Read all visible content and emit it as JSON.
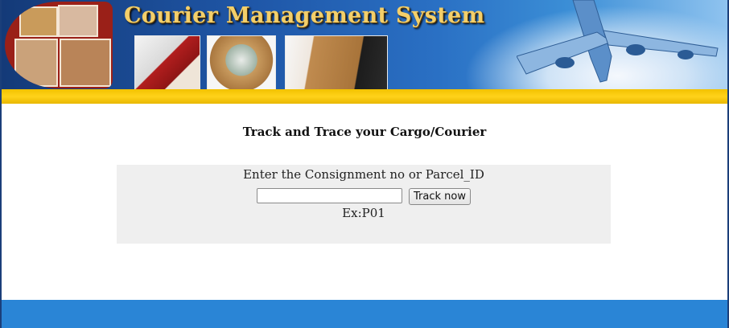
{
  "header": {
    "title": "Courier Management System",
    "images": [
      "courier-boxes-collage",
      "delivery-person-handover",
      "globe-with-parcels",
      "hands-passing-parcel",
      "airplane-over-world-map"
    ]
  },
  "colors": {
    "border": "#1b3f7a",
    "gold_bar": "#ffd21a",
    "title_text": "#f3cf6a",
    "panel_bg": "#efefef",
    "footer": "#2a85d6"
  },
  "tracking": {
    "heading": "Track and Trace your Cargo/Courier",
    "prompt": "Enter the Consignment no or Parcel_ID",
    "input_value": "",
    "button_label": "Track now",
    "example": "Ex:P01"
  }
}
